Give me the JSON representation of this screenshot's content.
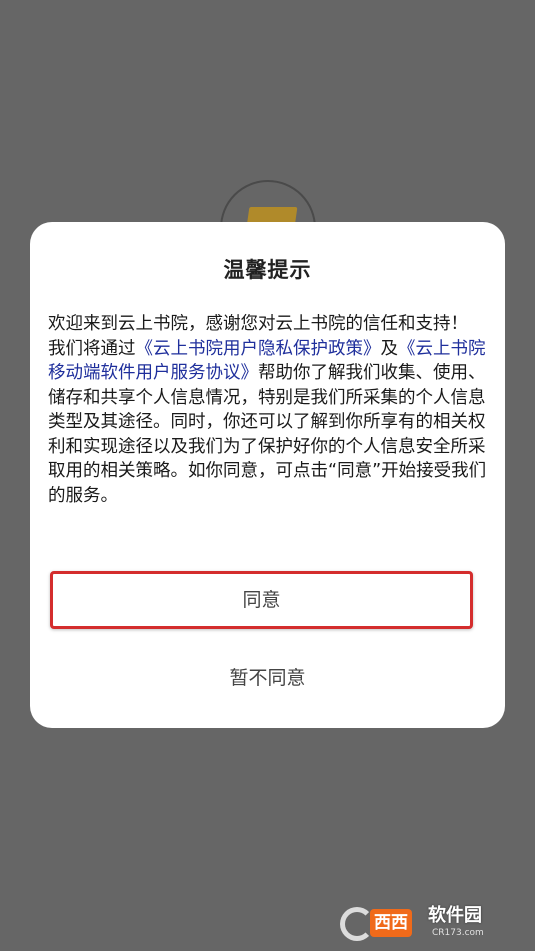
{
  "dialog": {
    "title": "温馨提示",
    "body": {
      "intro": "欢迎来到云上书院，感谢您对云上书院的信任和支持！",
      "line2_prefix": "我们将通过",
      "privacy_policy_link": "《云上书院用户隐私保护政策》",
      "conjunction": "及",
      "service_agreement_link": "《云上书院移动端软件用户服务协议》",
      "rest": "帮助你了解我们收集、使用、储存和共享个人信息情况，特别是我们所采集的个人信息类型及其途径。同时，你还可以了解到你所享有的相关权利和实现途径以及我们为了保护好你的个人信息安全所采取用的相关策略。如你同意，可点击“同意”开始接受我们的服务。"
    },
    "agree_label": "同意",
    "disagree_label": "暂不同意"
  },
  "watermark": {
    "brand": "西西",
    "text": "软件园",
    "url": "CR173.com"
  },
  "colors": {
    "backdrop": "#666666",
    "link": "#1f2f9c",
    "agree_border": "#d42d2d",
    "watermark_accent": "#f06a1a"
  }
}
